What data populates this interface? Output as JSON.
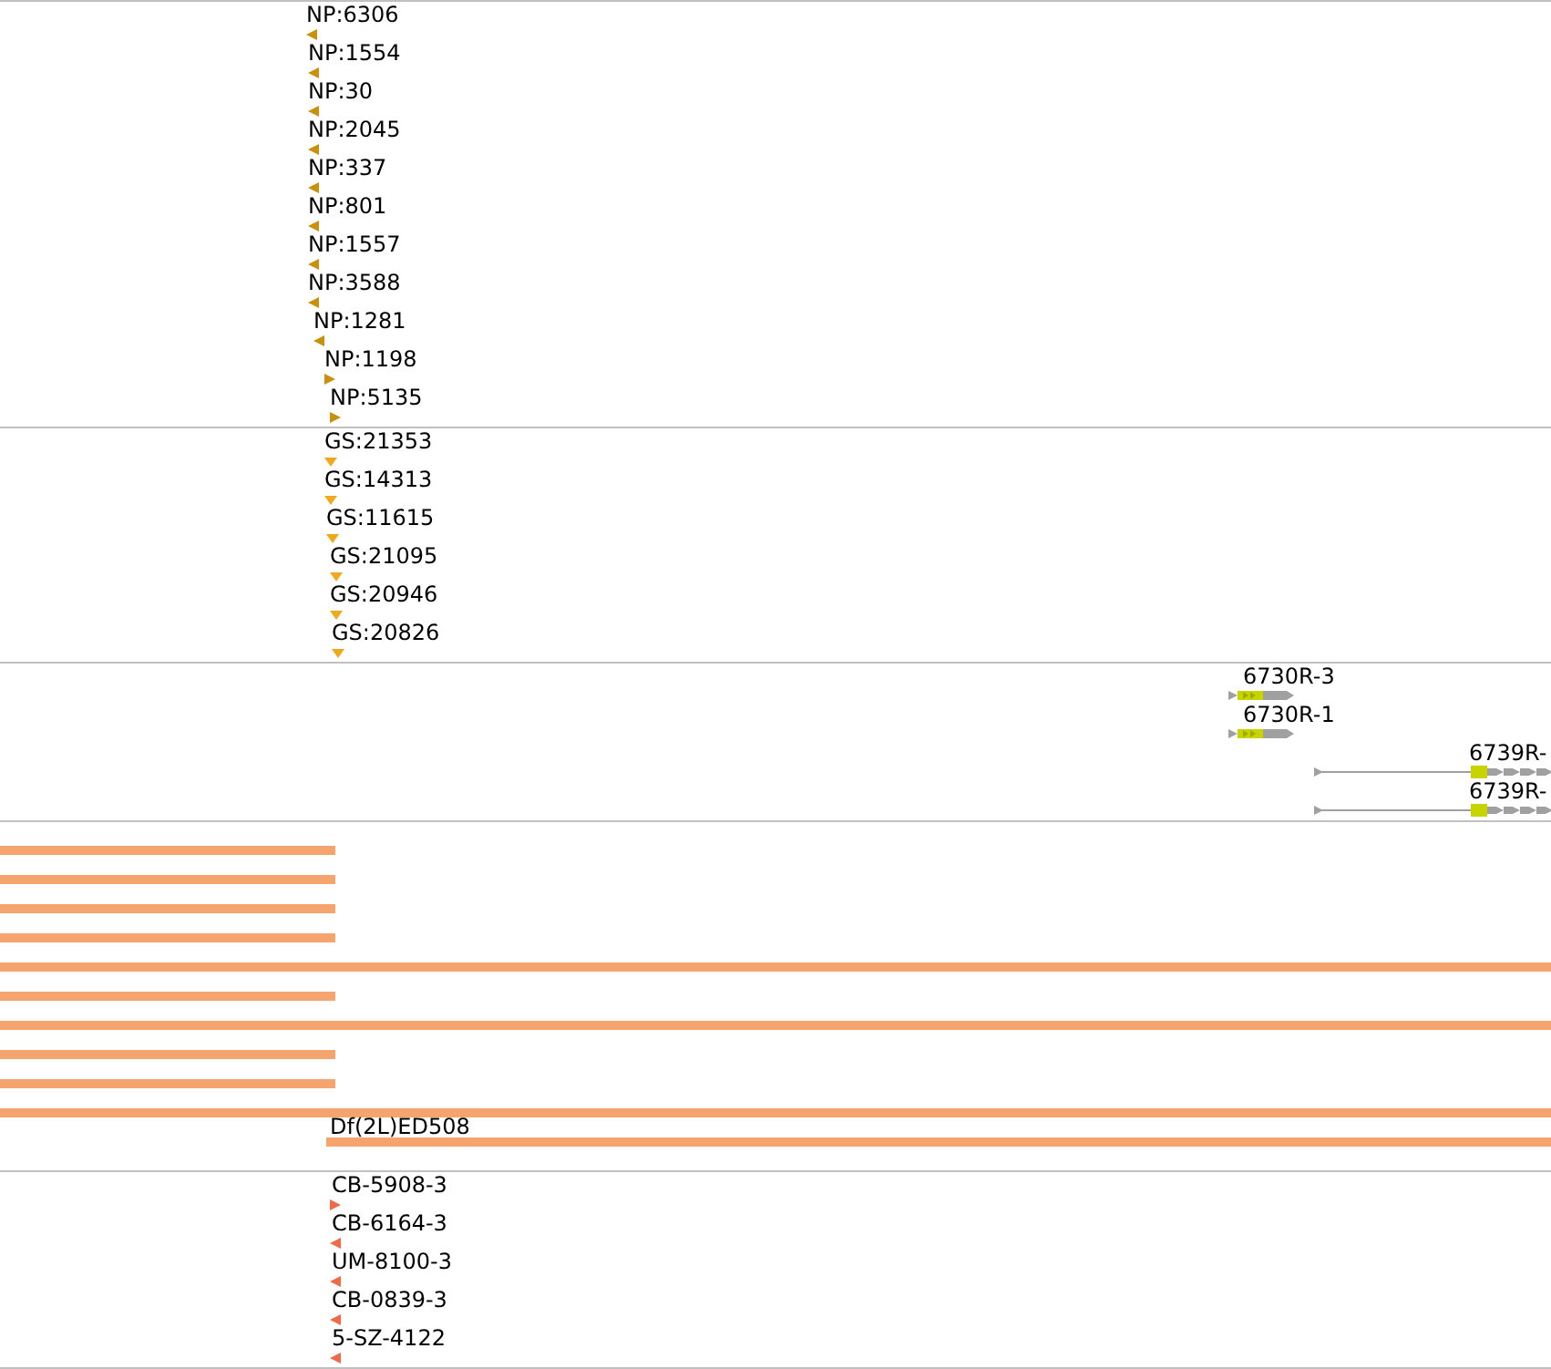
{
  "tracks": [
    {
      "kind": "markers",
      "color": "#c8900c",
      "features": [
        {
          "label": "NP:6306",
          "kind": "left-triangle"
        },
        {
          "label": "NP:1554",
          "kind": "left-triangle"
        },
        {
          "label": "NP:30",
          "kind": "left-triangle"
        },
        {
          "label": "NP:2045",
          "kind": "left-triangle"
        },
        {
          "label": "NP:337",
          "kind": "left-triangle"
        },
        {
          "label": "NP:801",
          "kind": "left-triangle"
        },
        {
          "label": "NP:1557",
          "kind": "left-triangle"
        },
        {
          "label": "NP:3588",
          "kind": "left-triangle"
        },
        {
          "label": "NP:1281",
          "kind": "left-triangle"
        },
        {
          "label": "NP:1198",
          "kind": "right-triangle"
        },
        {
          "label": "NP:5135",
          "kind": "right-triangle"
        }
      ]
    },
    {
      "kind": "markers",
      "color": "#f0a81c",
      "features": [
        {
          "label": "GS:21353",
          "kind": "down-triangle"
        },
        {
          "label": "GS:14313",
          "kind": "down-triangle"
        },
        {
          "label": "GS:11615",
          "kind": "down-triangle"
        },
        {
          "label": "GS:21095",
          "kind": "down-triangle"
        },
        {
          "label": "GS:20946",
          "kind": "down-triangle"
        },
        {
          "label": "GS:20826",
          "kind": "down-triangle"
        }
      ]
    },
    {
      "kind": "gene-models",
      "features": [
        {
          "label": "6730R-3",
          "kind": "compact"
        },
        {
          "label": "6730R-1",
          "kind": "compact"
        },
        {
          "label": "6739R-",
          "kind": "long"
        },
        {
          "label": "6739R-",
          "kind": "long"
        }
      ]
    },
    {
      "kind": "bars",
      "features": [
        {
          "kind": "ends-in-view"
        },
        {
          "kind": "ends-in-view"
        },
        {
          "kind": "ends-in-view"
        },
        {
          "kind": "ends-in-view"
        },
        {
          "kind": "spans-view"
        },
        {
          "kind": "ends-in-view"
        },
        {
          "kind": "spans-view"
        },
        {
          "kind": "ends-in-view"
        },
        {
          "kind": "ends-in-view"
        },
        {
          "kind": "spans-view"
        },
        {
          "kind": "starts-in-view",
          "label": "Df(2L)ED508"
        }
      ]
    },
    {
      "kind": "markers",
      "color": "#f06a48",
      "features": [
        {
          "label": "CB-5908-3",
          "kind": "right-triangle"
        },
        {
          "label": "CB-6164-3",
          "kind": "left-triangle"
        },
        {
          "label": "UM-8100-3",
          "kind": "left-triangle"
        },
        {
          "label": "CB-0839-3",
          "kind": "left-triangle"
        },
        {
          "label": "5-SZ-4122",
          "kind": "left-triangle"
        }
      ]
    }
  ]
}
